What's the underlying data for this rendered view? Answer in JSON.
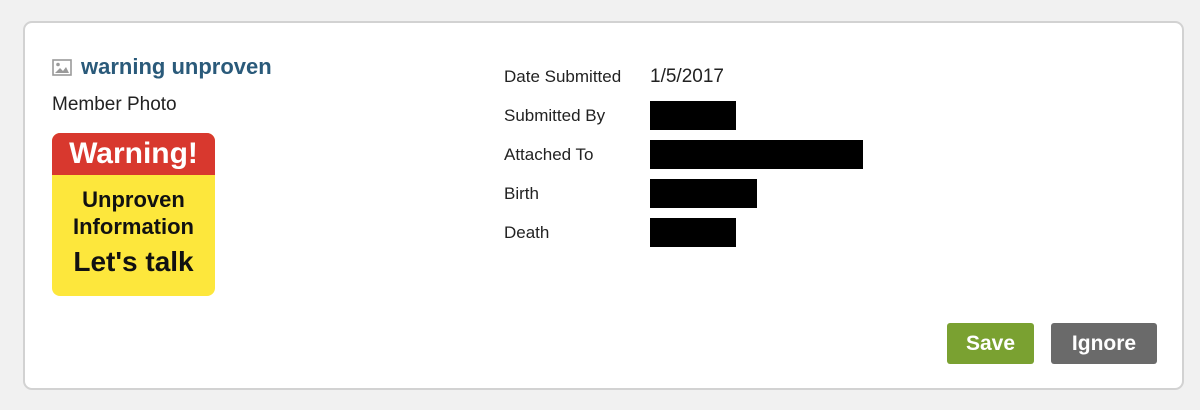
{
  "item": {
    "title": "warning unproven",
    "title_icon": "image-icon",
    "type_label": "Member Photo",
    "thumbnail": {
      "line_top": "Warning!",
      "line_1": "Unproven",
      "line_2": "Information",
      "line_3": "Let's talk",
      "colors": {
        "top_band": "#d8382e",
        "background": "#fde73c"
      }
    }
  },
  "details": {
    "date_submitted": {
      "label": "Date Submitted",
      "value": "1/5/2017"
    },
    "submitted_by": {
      "label": "Submitted By",
      "value_redacted": true
    },
    "attached_to": {
      "label": "Attached To",
      "value_redacted": true
    },
    "birth": {
      "label": "Birth",
      "value_redacted": true
    },
    "death": {
      "label": "Death",
      "value_redacted": true
    }
  },
  "actions": {
    "save_label": "Save",
    "ignore_label": "Ignore",
    "colors": {
      "save": "#7aa131",
      "ignore": "#6a6a6a"
    }
  },
  "colors": {
    "title_link": "#2a5a7a",
    "card_border": "#d2d2d2",
    "page_bg": "#f1f1f1"
  }
}
